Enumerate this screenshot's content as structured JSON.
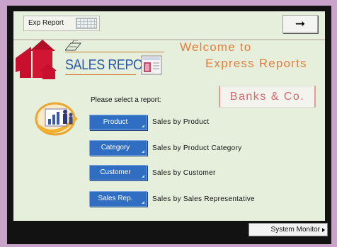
{
  "window": {
    "tab_label": "Exp Report",
    "nav_arrow": "➞"
  },
  "header": {
    "sales_report_title": "SALES REPORT",
    "welcome_line1": "Welcome to",
    "welcome_line2": "Express Reports"
  },
  "main": {
    "select_prompt": "Please select a report:",
    "company_name": "Banks & Co.",
    "reports": [
      {
        "button_label": "Product",
        "description": "Sales by Product"
      },
      {
        "button_label": "Category",
        "description": "Sales by Product Category"
      },
      {
        "button_label": "Customer",
        "description": "Sales by Customer"
      },
      {
        "button_label": "Sales Rep.",
        "description": "Sales by Sales Representative"
      }
    ]
  },
  "footer": {
    "system_monitor_label": "System Monitor"
  },
  "icons": {
    "logo": "red-house-icon",
    "printer": "printer-icon",
    "document": "document-icon",
    "people": "people-chart-icon",
    "next": "right-arrow-icon"
  },
  "colors": {
    "button_blue": "#2f6ec2",
    "title_blue": "#2a5aa6",
    "welcome_orange": "#e57e3c",
    "company_red": "#d26a6a",
    "panel_bg": "#e6eedc",
    "frame_purple": "#c9a3c9"
  }
}
